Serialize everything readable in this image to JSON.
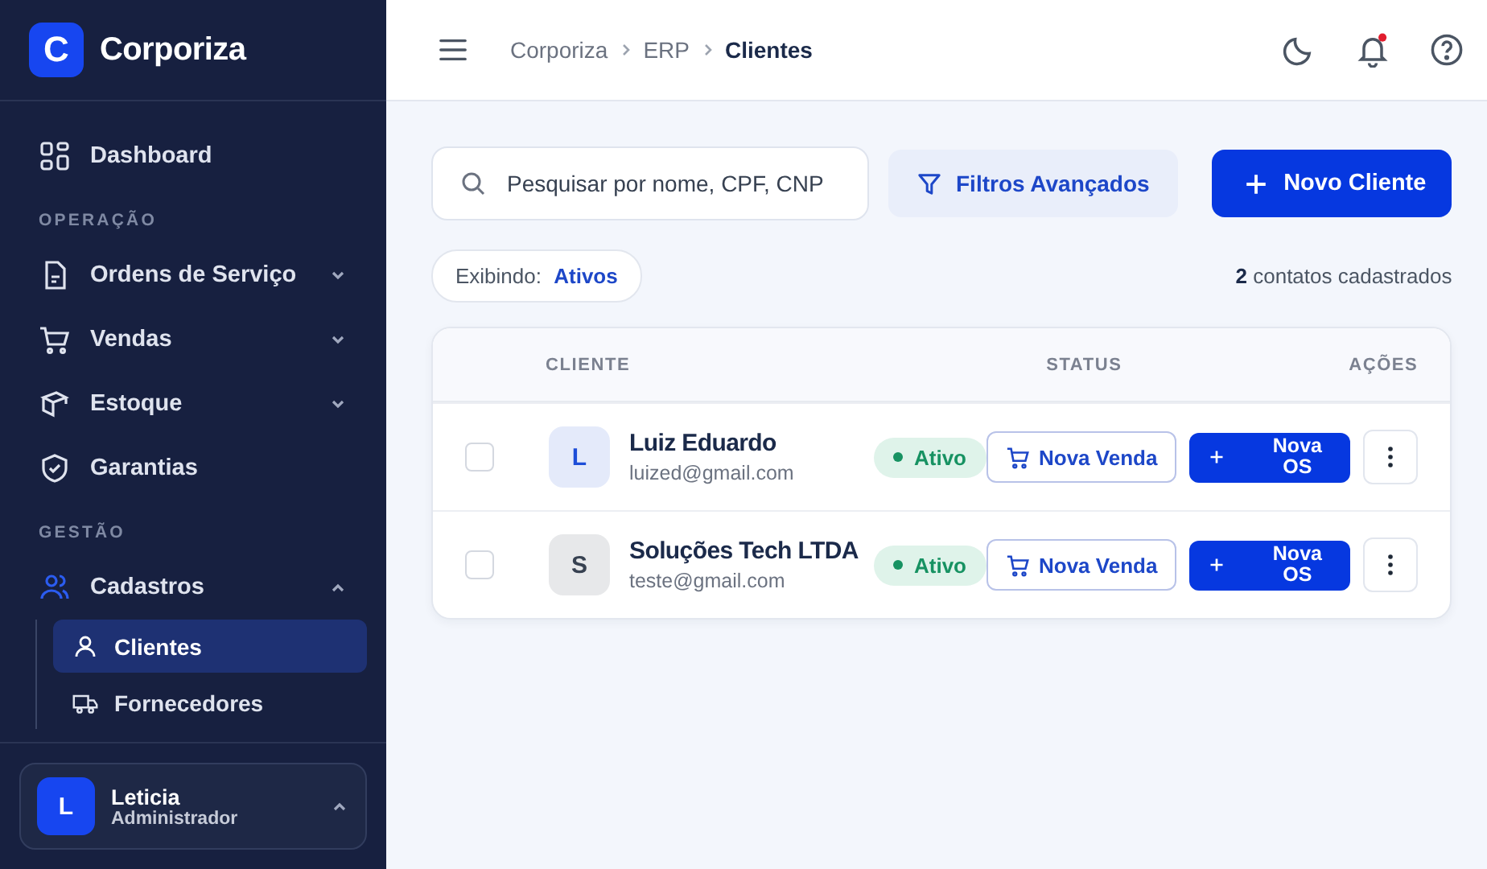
{
  "brand": {
    "name": "Corporiza",
    "logo_letter": "C"
  },
  "sidebar": {
    "items": [
      {
        "kind": "link",
        "label": "Dashboard",
        "selected": false
      },
      {
        "kind": "section",
        "label": "OPERAÇÃO"
      },
      {
        "kind": "group",
        "label": "Ordens de Serviço",
        "expanded": false
      },
      {
        "kind": "group",
        "label": "Vendas",
        "expanded": false
      },
      {
        "kind": "group",
        "label": "Estoque",
        "expanded": false
      },
      {
        "kind": "link",
        "label": "Garantias",
        "selected": false
      },
      {
        "kind": "section",
        "label": "GESTÃO"
      },
      {
        "kind": "group",
        "label": "Cadastros",
        "expanded": true,
        "children": [
          {
            "label": "Clientes",
            "selected": true
          },
          {
            "label": "Fornecedores",
            "selected": false
          }
        ]
      }
    ]
  },
  "user": {
    "initial": "L",
    "name": "Leticia",
    "role": "Administrador"
  },
  "breadcrumb": [
    "Corporiza",
    "ERP",
    "Clientes"
  ],
  "header": {
    "has_unread_notifications": true
  },
  "search": {
    "placeholder": "Pesquisar por nome, CPF, CNP"
  },
  "filters_button": "Filtros Avançados",
  "new_button": "Novo Cliente",
  "filter_chip": {
    "label": "Exibindo:",
    "value": "Ativos"
  },
  "count": {
    "number": "2",
    "label": "contatos cadastrados"
  },
  "table": {
    "columns": [
      "CLIENTE",
      "STATUS",
      "AÇÕES"
    ],
    "rows": [
      {
        "initial": "L",
        "color": "#1d4ed8",
        "name": "Luiz Eduardo",
        "email": "luized@gmail.com",
        "status": "Ativo",
        "checked": false,
        "sale_button": "Nova Venda",
        "os_button": "Nova OS"
      },
      {
        "initial": "S",
        "color": "#374151",
        "name": "Soluções Tech LTDA",
        "email": "teste@gmail.com",
        "status": "Ativo",
        "checked": false,
        "sale_button": "Nova Venda",
        "os_button": "Nova OS"
      }
    ]
  }
}
